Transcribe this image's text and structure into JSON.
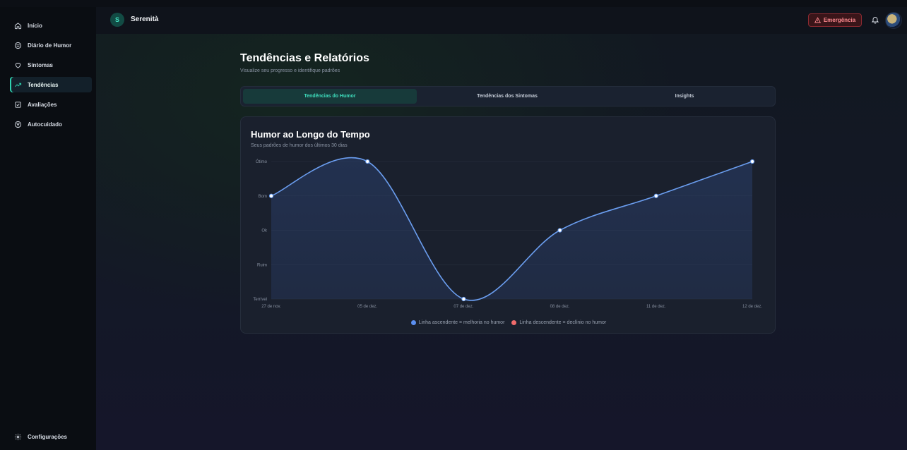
{
  "app": {
    "logo_letter": "S",
    "name": "Serenità"
  },
  "sidebar": {
    "items": [
      {
        "label": "Início",
        "icon": "home-icon"
      },
      {
        "label": "Diário de Humor",
        "icon": "smile-icon"
      },
      {
        "label": "Sintomas",
        "icon": "heart-icon"
      },
      {
        "label": "Tendências",
        "icon": "trending-up-icon",
        "active": true
      },
      {
        "label": "Avaliações",
        "icon": "checkbox-icon"
      },
      {
        "label": "Autocuidado",
        "icon": "lotus-icon"
      }
    ],
    "settings_label": "Configurações"
  },
  "header": {
    "emergency_label": "Emergência"
  },
  "page": {
    "title": "Tendências e Relatórios",
    "subtitle": "Visualize seu progresso e identifique padrões"
  },
  "tabs": [
    {
      "label": "Tendências do Humor",
      "active": true
    },
    {
      "label": "Tendências dos Sintomas"
    },
    {
      "label": "Insights"
    }
  ],
  "card": {
    "title": "Humor ao Longo do Tempo",
    "subtitle": "Seus padrões de humor dos últimos 30 dias"
  },
  "chart_data": {
    "type": "area",
    "categories": [
      "27 de nov.",
      "05 de dez.",
      "07 de dez.",
      "08 de dez.",
      "11 de dez.",
      "12 de dez."
    ],
    "y_levels": [
      "Terrível",
      "Ruim",
      "Ok",
      "Bom",
      "Ótimo"
    ],
    "values": [
      4,
      5,
      1,
      3,
      4,
      5
    ],
    "ylim": [
      1,
      5
    ],
    "grid": true,
    "line_color": "#6b9ef0",
    "fill_color": "#2a3f6c",
    "legend": [
      {
        "label": "Linha ascendente = melhoria no humor",
        "color": "#5b8ff0"
      },
      {
        "label": "Linha descendente = declínio no humor",
        "color": "#f06b6b"
      }
    ]
  },
  "colors": {
    "accent": "#2fd3b0",
    "emergency": "#ff8a90"
  }
}
